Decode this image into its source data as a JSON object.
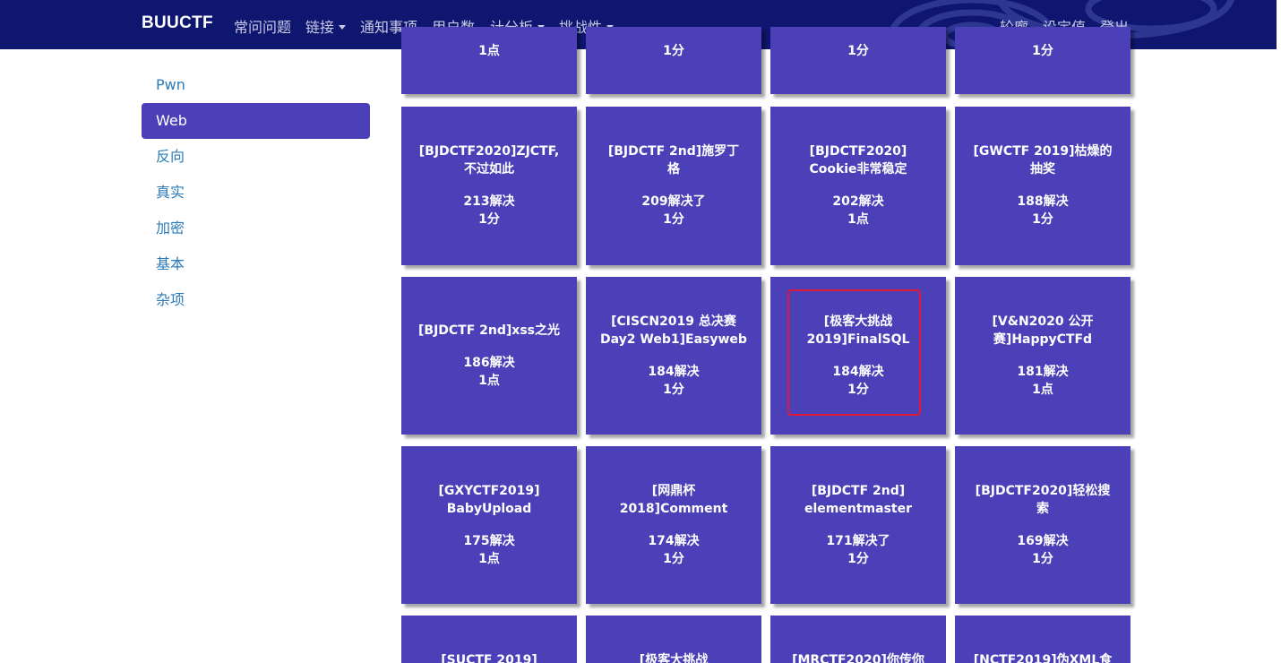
{
  "navbar": {
    "brand": "BUUCTF",
    "left_items": [
      {
        "label": "常问问题",
        "dropdown": false
      },
      {
        "label": "链接",
        "dropdown": true
      },
      {
        "label": "通知事项",
        "dropdown": false
      },
      {
        "label": "用户数",
        "dropdown": false
      },
      {
        "label": "计分板",
        "dropdown": true
      },
      {
        "label": "挑战性",
        "dropdown": true
      }
    ],
    "right_items": [
      {
        "label": "轮廓"
      },
      {
        "label": "设定值"
      },
      {
        "label": "登出"
      }
    ]
  },
  "sidebar": {
    "items": [
      {
        "label": "Pwn",
        "active": false
      },
      {
        "label": "Web",
        "active": true
      },
      {
        "label": "反向",
        "active": false
      },
      {
        "label": "真实",
        "active": false
      },
      {
        "label": "加密",
        "active": false
      },
      {
        "label": "基本",
        "active": false
      },
      {
        "label": "杂项",
        "active": false
      }
    ]
  },
  "challenges": {
    "top_partial": [
      {
        "points": "1点"
      },
      {
        "points": "1分"
      },
      {
        "points": "1分"
      },
      {
        "points": "1分"
      }
    ],
    "rows": [
      [
        {
          "title_lines": [
            "[BJDCTF2020]ZJCTF,",
            "不过如此"
          ],
          "solves": "213解决",
          "points": "1分"
        },
        {
          "title_lines": [
            "[BJDCTF 2nd]施罗丁",
            "格"
          ],
          "solves": "209解决了",
          "points": "1分"
        },
        {
          "title_lines": [
            "[BJDCTF2020]",
            "Cookie非常稳定"
          ],
          "solves": "202解决",
          "points": "1点"
        },
        {
          "title_lines": [
            "[GWCTF 2019]枯燥的",
            "抽奖"
          ],
          "solves": "188解决",
          "points": "1分"
        }
      ],
      [
        {
          "title_lines": [
            "[BJDCTF 2nd]xss之光"
          ],
          "solves": "186解决",
          "points": "1点"
        },
        {
          "title_lines": [
            "[CISCN2019 总决赛",
            "Day2 Web1]Easyweb"
          ],
          "solves": "184解决",
          "points": "1分"
        },
        {
          "title_lines": [
            "[极客大挑战",
            "2019]FinalSQL"
          ],
          "solves": "184解决",
          "points": "1分",
          "focused": true
        },
        {
          "title_lines": [
            "[V&N2020 公开",
            "赛]HappyCTFd"
          ],
          "solves": "181解决",
          "points": "1点"
        }
      ],
      [
        {
          "title_lines": [
            "[GXYCTF2019]",
            "BabyUpload"
          ],
          "solves": "175解决",
          "points": "1点"
        },
        {
          "title_lines": [
            "[网鼎杯",
            "2018]Comment"
          ],
          "solves": "174解决",
          "points": "1分"
        },
        {
          "title_lines": [
            "[BJDCTF 2nd]",
            "elementmaster"
          ],
          "solves": "171解决了",
          "points": "1分"
        },
        {
          "title_lines": [
            "[BJDCTF2020]轻松搜",
            "索"
          ],
          "solves": "169解决",
          "points": "1分"
        }
      ]
    ],
    "bottom_partial": [
      {
        "title_line": "[SUCTF 2019]"
      },
      {
        "title_line": "[极客大挑战"
      },
      {
        "title_line": "[MRCTF2020]你传你"
      },
      {
        "title_line": "[NCTF2019]伪XML食"
      }
    ]
  }
}
